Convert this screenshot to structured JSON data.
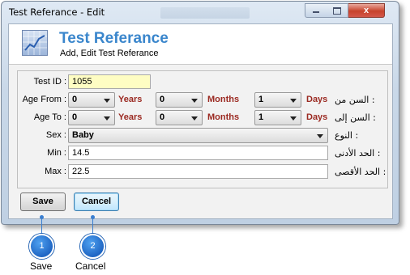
{
  "window": {
    "title": "Test Referance - Edit",
    "close_glyph": "x"
  },
  "header": {
    "icon": "chart-icon",
    "title": "Test Referance",
    "subtitle": "Add, Edit Test Referance"
  },
  "form": {
    "test_id": {
      "label": "Test ID :",
      "value": "1055"
    },
    "age_from": {
      "label": "Age From :",
      "years": "0",
      "months": "0",
      "days": "1",
      "years_label": "Years",
      "months_label": "Months",
      "days_label": "Days",
      "label_ar": "السن من :"
    },
    "age_to": {
      "label": "Age To :",
      "years": "0",
      "months": "0",
      "days": "1",
      "years_label": "Years",
      "months_label": "Months",
      "days_label": "Days",
      "label_ar": "السن إلى :"
    },
    "sex": {
      "label": "Sex :",
      "value": "Baby",
      "label_ar": "النوع :"
    },
    "min": {
      "label": "Min :",
      "value": "14.5",
      "label_ar": "الحد الأدنى :"
    },
    "max": {
      "label": "Max :",
      "value": "22.5",
      "label_ar": "الحد الأقصى :"
    }
  },
  "buttons": {
    "save": "Save",
    "cancel": "Cancel"
  },
  "callouts": [
    {
      "number": "1",
      "label": "Save"
    },
    {
      "number": "2",
      "label": "Cancel"
    }
  ],
  "colors": {
    "accent": "#3a86cc",
    "unit_label": "#9b2a22",
    "callout": "#1f66c4"
  }
}
